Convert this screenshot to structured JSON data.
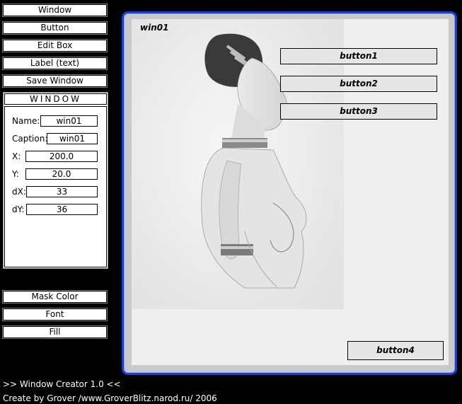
{
  "toolbar": {
    "window_label": "Window",
    "button_label": "Button",
    "editbox_label": "Edit Box",
    "label_label": "Label (text)",
    "save_label": "Save Window"
  },
  "properties": {
    "title": "WINDOW",
    "name_label": "Name:",
    "name_value": "win01",
    "caption_label": "Caption:",
    "caption_value": "win01",
    "x_label": "X:",
    "x_value": "200.0",
    "y_label": "Y:",
    "y_value": "20.0",
    "dx_label": "dX:",
    "dx_value": "33",
    "dy_label": "dY:",
    "dy_value": "36"
  },
  "tools": {
    "mask_label": "Mask Color",
    "font_label": "Font",
    "fill_label": "Fill"
  },
  "preview": {
    "title": "win01",
    "button1": "button1",
    "button2": "button2",
    "button3": "button3",
    "button4": "button4"
  },
  "footer": {
    "app_name": ">> Window Creator 1.0 <<",
    "credit": "Create by Grover /www.GroverBlitz.narod.ru/ 2006"
  },
  "colors": {
    "frame_border": "#1a3fd6",
    "background": "#000000"
  }
}
